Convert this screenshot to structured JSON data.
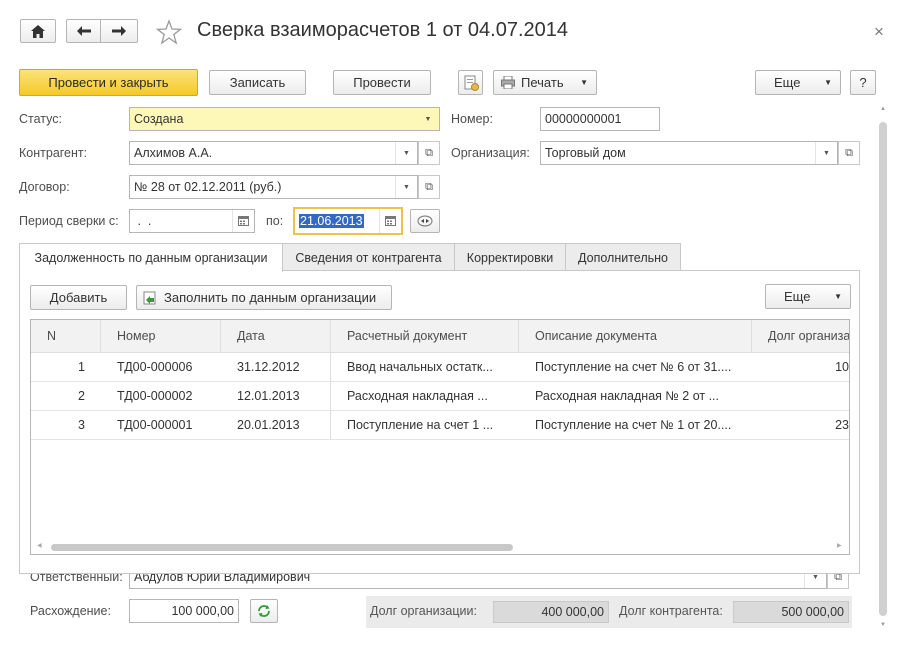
{
  "window": {
    "title": "Сверка взаиморасчетов 1 от 04.07.2014",
    "close_glyph": "×"
  },
  "toolbar": {
    "post_close_label": "Провести и закрыть",
    "save_label": "Записать",
    "post_label": "Провести",
    "print_label": "Печать",
    "more_label": "Еще",
    "help_label": "?"
  },
  "form": {
    "status_label": "Статус:",
    "status_value": "Создана",
    "number_label": "Номер:",
    "number_value": "00000000001",
    "counterparty_label": "Контрагент:",
    "counterparty_value": "Алхимов А.А.",
    "organization_label": "Организация:",
    "organization_value": "Торговый дом",
    "contract_label": "Договор:",
    "contract_value": "№ 28 от 02.12.2011 (руб.)",
    "period_label": "Период сверки с:",
    "period_from_value": " .  .",
    "period_to_label": "по:",
    "period_to_value": "21.06.2013"
  },
  "tabs": [
    {
      "label": "Задолженность по данным организации"
    },
    {
      "label": "Сведения от контрагента"
    },
    {
      "label": "Корректировки"
    },
    {
      "label": "Дополнительно"
    }
  ],
  "table_toolbar": {
    "add_label": "Добавить",
    "fill_label": "Заполнить по данным организации",
    "more_label": "Еще"
  },
  "table": {
    "columns": [
      "N",
      "Номер",
      "Дата",
      "Расчетный документ",
      "Описание документа",
      "Долг организа"
    ],
    "rows": [
      {
        "n": "1",
        "number": "ТД00-000006",
        "date": "31.12.2012",
        "doc": "Ввод начальных остатк...",
        "desc": "Поступление на счет № 6 от 31....",
        "debt": "10"
      },
      {
        "n": "2",
        "number": "ТД00-000002",
        "date": "12.01.2013",
        "doc": "Расходная накладная ...",
        "desc": "Расходная накладная № 2 от ...",
        "debt": ""
      },
      {
        "n": "3",
        "number": "ТД00-000001",
        "date": "20.01.2013",
        "doc": "Поступление на счет 1 ...",
        "desc": "Поступление на счет № 1 от 20....",
        "debt": "23"
      }
    ]
  },
  "footer": {
    "responsible_label": "Ответственный:",
    "responsible_value": "Абдулов Юрий Владимирович",
    "discrepancy_label": "Расхождение:",
    "discrepancy_value": "100 000,00",
    "org_debt_label": "Долг организации:",
    "org_debt_value": "400 000,00",
    "cp_debt_label": "Долг контрагента:",
    "cp_debt_value": "500 000,00"
  },
  "colors": {
    "primary_button": "#f5c927",
    "status_field": "#fdf8b8",
    "selected_date": "#3369c4"
  }
}
